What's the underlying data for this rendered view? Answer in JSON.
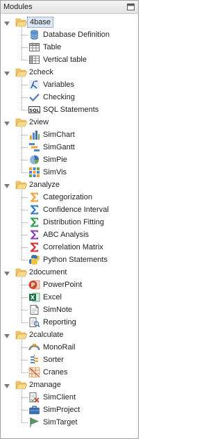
{
  "panel": {
    "title": "Modules"
  },
  "groups": [
    {
      "label": "4base",
      "selected": true,
      "children": [
        {
          "label": "Database Definition",
          "icon": "database-icon"
        },
        {
          "label": "Table",
          "icon": "table-icon"
        },
        {
          "label": "Vertical table",
          "icon": "vertical-table-icon"
        }
      ]
    },
    {
      "label": "2check",
      "children": [
        {
          "label": "Variables",
          "icon": "variable-icon"
        },
        {
          "label": "Checking",
          "icon": "checkmark-icon"
        },
        {
          "label": "SQL Statements",
          "icon": "sql-icon"
        }
      ]
    },
    {
      "label": "2view",
      "children": [
        {
          "label": "SimChart",
          "icon": "bar-chart-icon"
        },
        {
          "label": "SimGantt",
          "icon": "gantt-icon"
        },
        {
          "label": "SimPie",
          "icon": "pie-chart-icon"
        },
        {
          "label": "SimVis",
          "icon": "grid-icon"
        }
      ]
    },
    {
      "label": "2analyze",
      "children": [
        {
          "label": "Categorization",
          "icon": "sigma-orange-icon"
        },
        {
          "label": "Confidence Interval",
          "icon": "sigma-blue-icon"
        },
        {
          "label": "Distribution Fitting",
          "icon": "sigma-green-icon"
        },
        {
          "label": "ABC Analysis",
          "icon": "sigma-purple-icon"
        },
        {
          "label": "Correlation Matrix",
          "icon": "sigma-red-icon"
        },
        {
          "label": "Python Statements",
          "icon": "python-icon"
        }
      ]
    },
    {
      "label": "2document",
      "children": [
        {
          "label": "PowerPoint",
          "icon": "powerpoint-icon"
        },
        {
          "label": "Excel",
          "icon": "excel-icon"
        },
        {
          "label": "SimNote",
          "icon": "note-icon"
        },
        {
          "label": "Reporting",
          "icon": "report-icon"
        }
      ]
    },
    {
      "label": "2calculate",
      "children": [
        {
          "label": "MonoRail",
          "icon": "monorail-icon"
        },
        {
          "label": "Sorter",
          "icon": "sorter-icon"
        },
        {
          "label": "Cranes",
          "icon": "crane-icon"
        }
      ]
    },
    {
      "label": "2manage",
      "children": [
        {
          "label": "SimClient",
          "icon": "client-icon"
        },
        {
          "label": "SimProject",
          "icon": "briefcase-icon"
        },
        {
          "label": "SimTarget",
          "icon": "flag-icon"
        }
      ]
    }
  ]
}
